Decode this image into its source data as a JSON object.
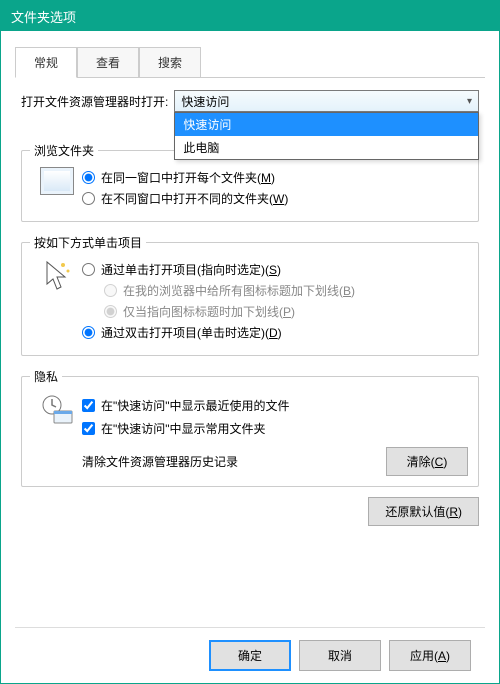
{
  "window": {
    "title": "文件夹选项"
  },
  "tabs": {
    "general": "常规",
    "view": "查看",
    "search": "搜索"
  },
  "open_in": {
    "label": "打开文件资源管理器时打开:",
    "selected": "快速访问",
    "options": [
      "快速访问",
      "此电脑"
    ]
  },
  "browse": {
    "title": "浏览文件夹",
    "opt1_pre": "在同一窗口中打开每个文件夹(",
    "opt1_key": "M",
    "opt1_post": ")",
    "opt2_pre": "在不同窗口中打开不同的文件夹(",
    "opt2_key": "W",
    "opt2_post": ")"
  },
  "click": {
    "title": "按如下方式单击项目",
    "opt1_pre": "通过单击打开项目(指向时选定)(",
    "opt1_key": "S",
    "opt1_post": ")",
    "sub1_pre": "在我的浏览器中给所有图标标题加下划线(",
    "sub1_key": "B",
    "sub1_post": ")",
    "sub2_pre": "仅当指向图标标题时加下划线(",
    "sub2_key": "P",
    "sub2_post": ")",
    "opt2_pre": "通过双击打开项目(单击时选定)(",
    "opt2_key": "D",
    "opt2_post": ")"
  },
  "privacy": {
    "title": "隐私",
    "chk1": "在\"快速访问\"中显示最近使用的文件",
    "chk2": "在\"快速访问\"中显示常用文件夹",
    "clear_label": "清除文件资源管理器历史记录",
    "clear_btn_pre": "清除(",
    "clear_btn_key": "C",
    "clear_btn_post": ")"
  },
  "restore": {
    "btn_pre": "还原默认值(",
    "btn_key": "R",
    "btn_post": ")"
  },
  "footer": {
    "ok": "确定",
    "cancel": "取消",
    "apply_pre": "应用(",
    "apply_key": "A",
    "apply_post": ")"
  }
}
